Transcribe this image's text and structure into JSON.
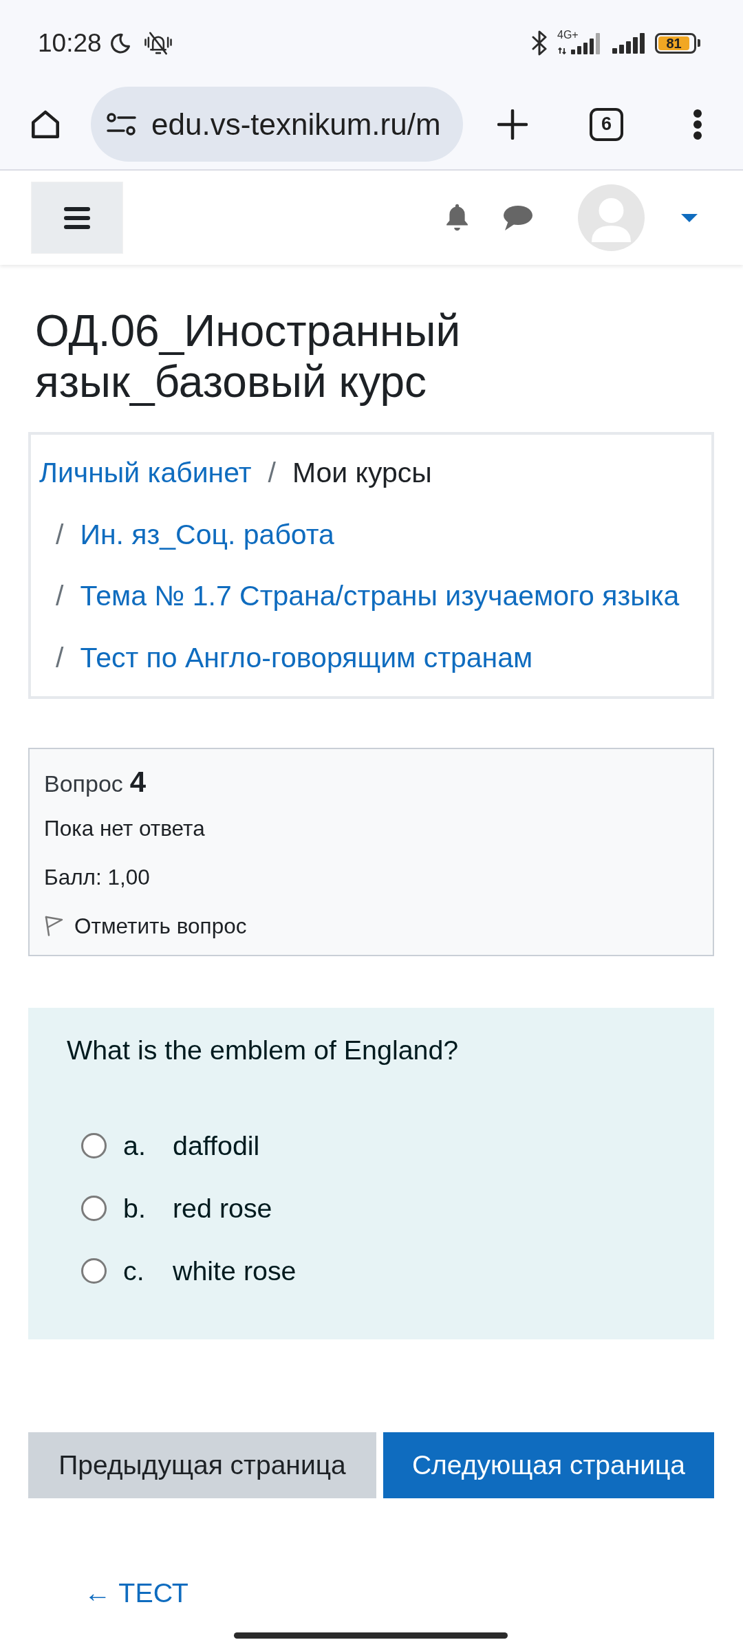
{
  "status_bar": {
    "time": "10:28",
    "network_type": "4G+",
    "battery": "81"
  },
  "browser_bar": {
    "url": "edu.vs-texnikum.ru/m",
    "tab_count": "6"
  },
  "page_title": "ОД.06_Иностранный язык_базовый курс",
  "breadcrumb": [
    {
      "label": "Личный кабинет",
      "kind": "link"
    },
    {
      "separator": "/",
      "label": "Мои курсы",
      "kind": "text"
    },
    {
      "separator": "/",
      "label": "Ин. яз_Соц. работа",
      "kind": "link"
    },
    {
      "separator": "/",
      "label": "Тема № 1.7 Страна/страны изучаемого языка",
      "kind": "link"
    },
    {
      "separator": "/",
      "label": "Тест по Англо-говорящим странам",
      "kind": "link"
    }
  ],
  "question_info": {
    "label": "Вопрос",
    "number": "4",
    "status": "Пока нет ответа",
    "grade": "Балл: 1,00",
    "flag_link": "Отметить вопрос"
  },
  "question": {
    "text": "What is the emblem of England?",
    "options": [
      {
        "letter": "a.",
        "text": "daffodil",
        "selected": false
      },
      {
        "letter": "b.",
        "text": "red rose",
        "selected": false
      },
      {
        "letter": "c.",
        "text": "white rose",
        "selected": false
      }
    ]
  },
  "page_buttons": [
    {
      "label": "Предыдущая страница",
      "kind": "secondary"
    },
    {
      "label": "Следующая страница",
      "kind": "primary"
    }
  ],
  "back_link": "← ТЕСТ"
}
